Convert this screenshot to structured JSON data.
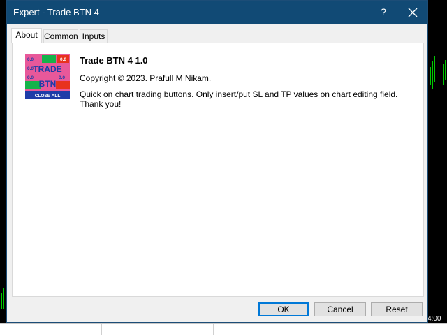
{
  "background": {
    "time_label": "4:00"
  },
  "dialog": {
    "title": "Expert - Trade BTN 4",
    "help_label": "?",
    "tabs": [
      {
        "label": "About"
      },
      {
        "label": "Common"
      },
      {
        "label": "Inputs"
      }
    ],
    "about": {
      "logo": {
        "row1": [
          "0.0",
          "0.0"
        ],
        "row2_left": "0.0",
        "row3": [
          "0.0",
          "0.0"
        ],
        "word1": "TRADE",
        "word2": "BTN",
        "bottom": "CLOSE ALL"
      },
      "name": "Trade BTN 4 1.0",
      "copyright": "Copyright © 2023. Prafull M Nikam.",
      "description": "Quick on chart trading buttons. Only insert/put SL and TP values on chart editing field.\nThank you!"
    },
    "buttons": {
      "ok": "OK",
      "cancel": "Cancel",
      "reset": "Reset"
    }
  },
  "colors": {
    "titlebar": "#114a75",
    "accent": "#0078d7",
    "logo_pink": "#e8589a",
    "logo_green": "#16b34a",
    "logo_red": "#e8321e",
    "logo_blue": "#1e3ca8"
  }
}
